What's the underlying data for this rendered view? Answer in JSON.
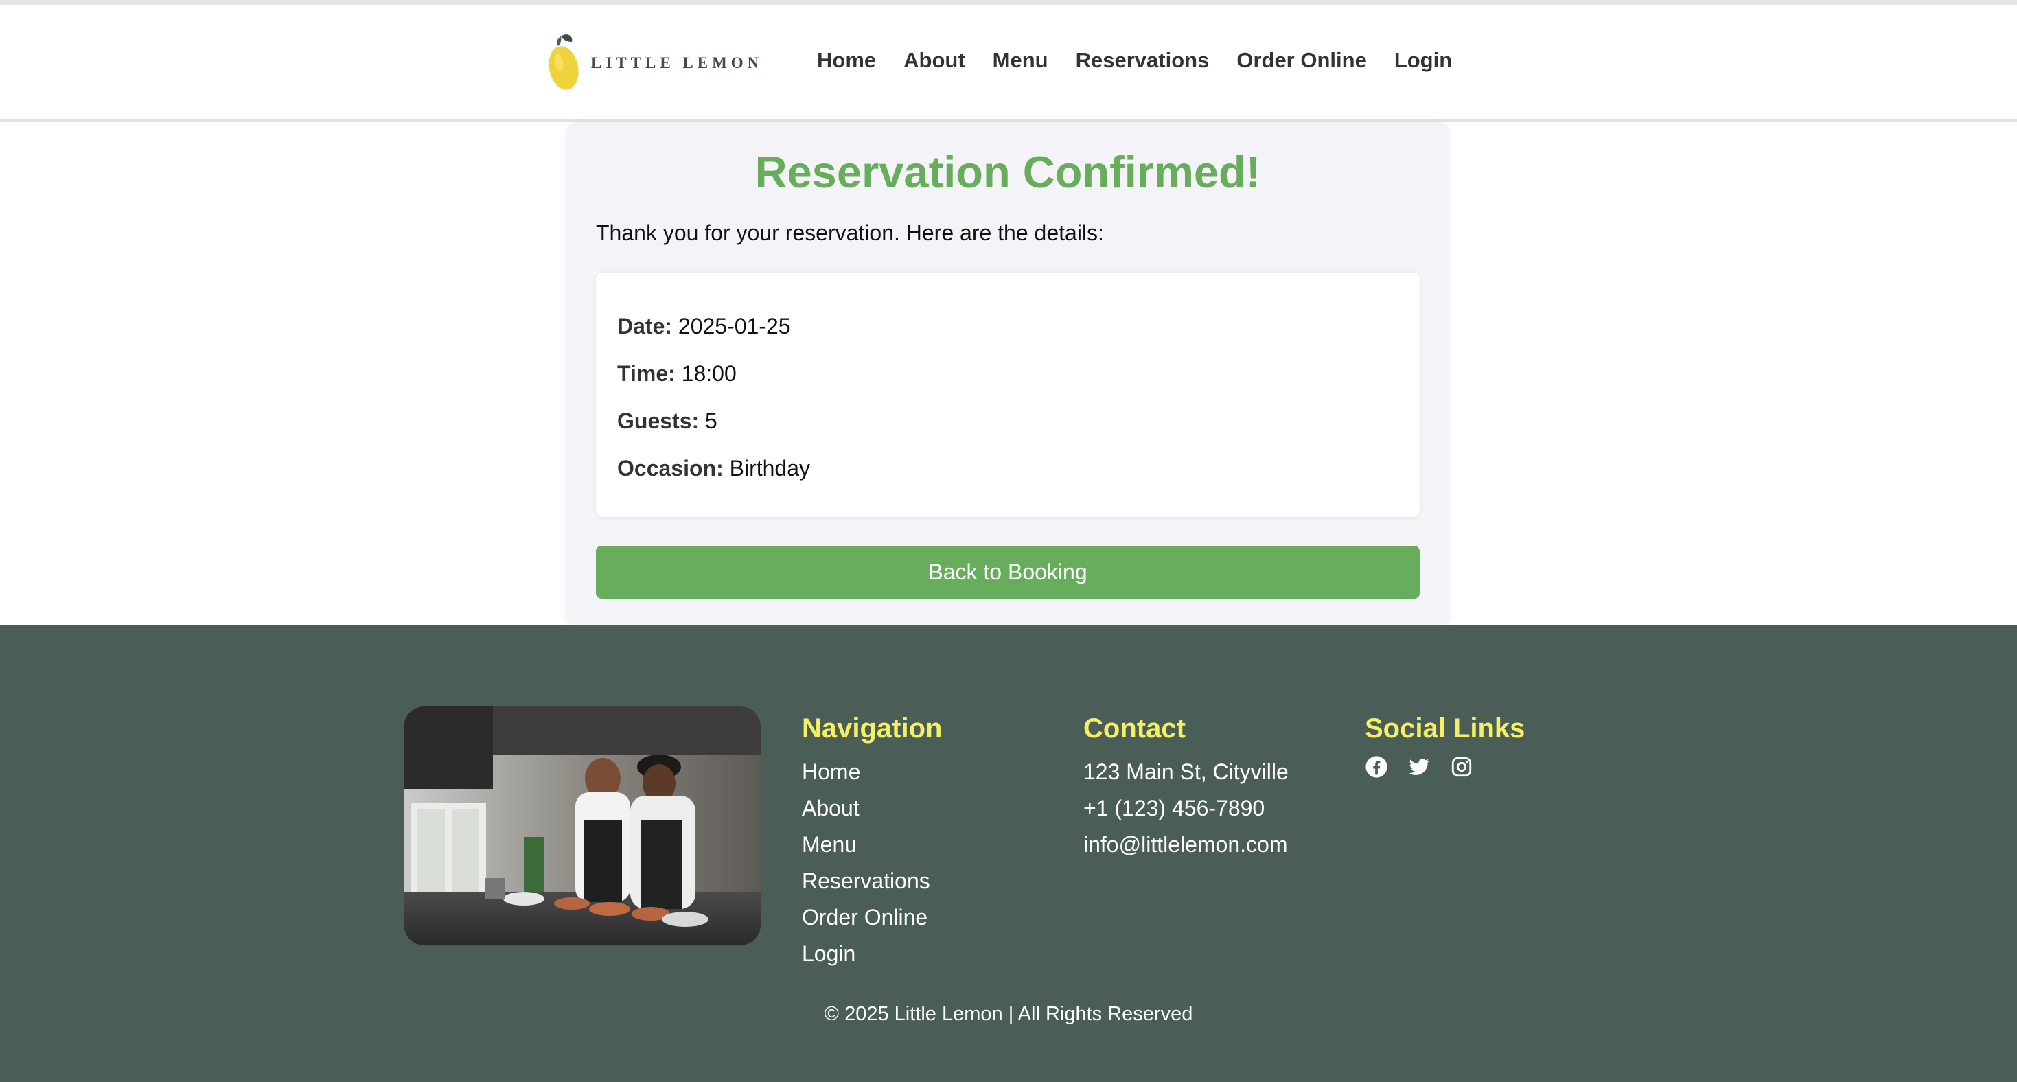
{
  "header": {
    "brand": "LITTLE LEMON",
    "nav": [
      "Home",
      "About",
      "Menu",
      "Reservations",
      "Order Online",
      "Login"
    ]
  },
  "confirmation": {
    "title": "Reservation Confirmed!",
    "intro": "Thank you for your reservation. Here are the details:",
    "details": [
      {
        "label": "Date:",
        "value": "2025-01-25"
      },
      {
        "label": "Time:",
        "value": "18:00"
      },
      {
        "label": "Guests:",
        "value": "5"
      },
      {
        "label": "Occasion:",
        "value": "Birthday"
      }
    ],
    "back_button": "Back to Booking"
  },
  "footer": {
    "navigation": {
      "heading": "Navigation",
      "links": [
        "Home",
        "About",
        "Menu",
        "Reservations",
        "Order Online",
        "Login"
      ]
    },
    "contact": {
      "heading": "Contact",
      "lines": [
        "123 Main St, Cityville",
        "+1 (123) 456-7890",
        "info@littlelemon.com"
      ]
    },
    "social": {
      "heading": "Social Links",
      "icons": [
        "facebook-icon",
        "twitter-icon",
        "instagram-icon"
      ]
    },
    "copyright": "© 2025 Little Lemon | All Rights Reserved"
  },
  "colors": {
    "accent_green": "#67ad5b",
    "footer_bg": "#4b5d57",
    "footer_heading": "#f4ef63",
    "card_bg": "#f4f4f8"
  }
}
